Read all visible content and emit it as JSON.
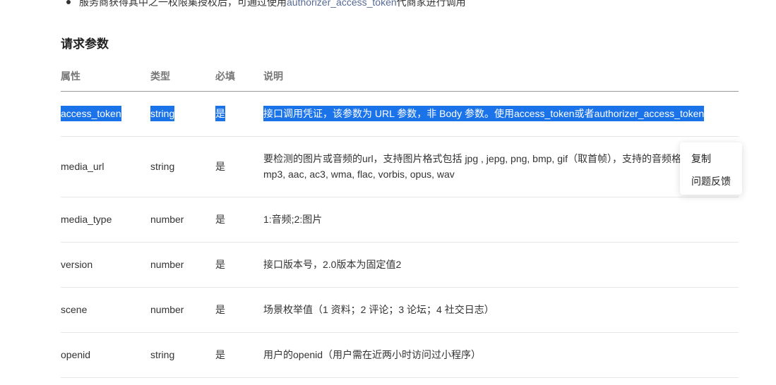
{
  "intro": {
    "text_before": "服务商获得其中之一权限集授权后，可通过使用",
    "link": "authorizer_access_token",
    "text_after": "代商家进行调用"
  },
  "section_title": "请求参数",
  "table": {
    "headers": [
      "属性",
      "类型",
      "必填",
      "说明"
    ],
    "rows": [
      {
        "name": "access_token",
        "type": "string",
        "required": "是",
        "desc_line1": "接口调用凭证，该参数为 URL 参数，非 Body 参数。使用access_token或者authorizer_access_token",
        "desc_line2": ""
      },
      {
        "name": "media_url",
        "type": "string",
        "required": "是",
        "desc_line1": "要检测的图片或音频的url，支持图片格式包括 jpg , jepg, png, bmp, gif（取首帧），支持的音频格式包括",
        "desc_line2": "mp3, aac, ac3, wma, flac, vorbis, opus, wav"
      },
      {
        "name": "media_type",
        "type": "number",
        "required": "是",
        "desc_line1": "1:音频;2:图片",
        "desc_line2": ""
      },
      {
        "name": "version",
        "type": "number",
        "required": "是",
        "desc_line1": "接口版本号，2.0版本为固定值2",
        "desc_line2": ""
      },
      {
        "name": "scene",
        "type": "number",
        "required": "是",
        "desc_line1": "场景枚举值（1 资料；2 评论；3 论坛；4 社交日志）",
        "desc_line2": ""
      },
      {
        "name": "openid",
        "type": "string",
        "required": "是",
        "desc_line1": "用户的openid（用户需在近两小时访问过小程序）",
        "desc_line2": ""
      }
    ]
  },
  "context_menu": {
    "items": [
      "复制",
      "问题反馈"
    ]
  },
  "colors": {
    "selection": "#1a73e8",
    "link": "#576b95"
  }
}
